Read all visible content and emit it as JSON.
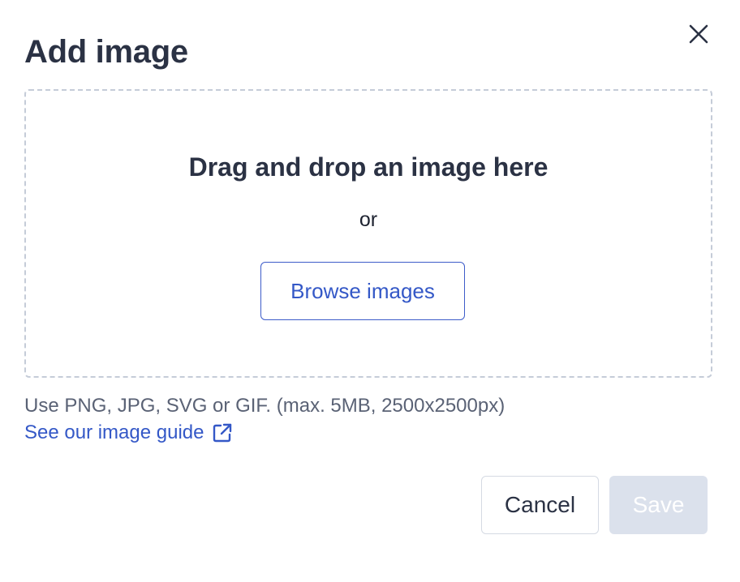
{
  "dialog": {
    "title": "Add image",
    "close_icon": "close-icon"
  },
  "dropzone": {
    "heading": "Drag and drop an image here",
    "separator": "or",
    "browse_label": "Browse images"
  },
  "hint": {
    "formats": "Use PNG, JPG, SVG or GIF. (max. 5MB, 2500x2500px)",
    "guide_link": "See our image guide",
    "guide_icon": "external-link-icon"
  },
  "actions": {
    "cancel_label": "Cancel",
    "save_label": "Save",
    "save_disabled": true
  },
  "colors": {
    "text_primary": "#2b3244",
    "accent": "#3458c7",
    "disabled_bg": "#dbe1ec",
    "dropzone_border": "#c5ccd8"
  }
}
